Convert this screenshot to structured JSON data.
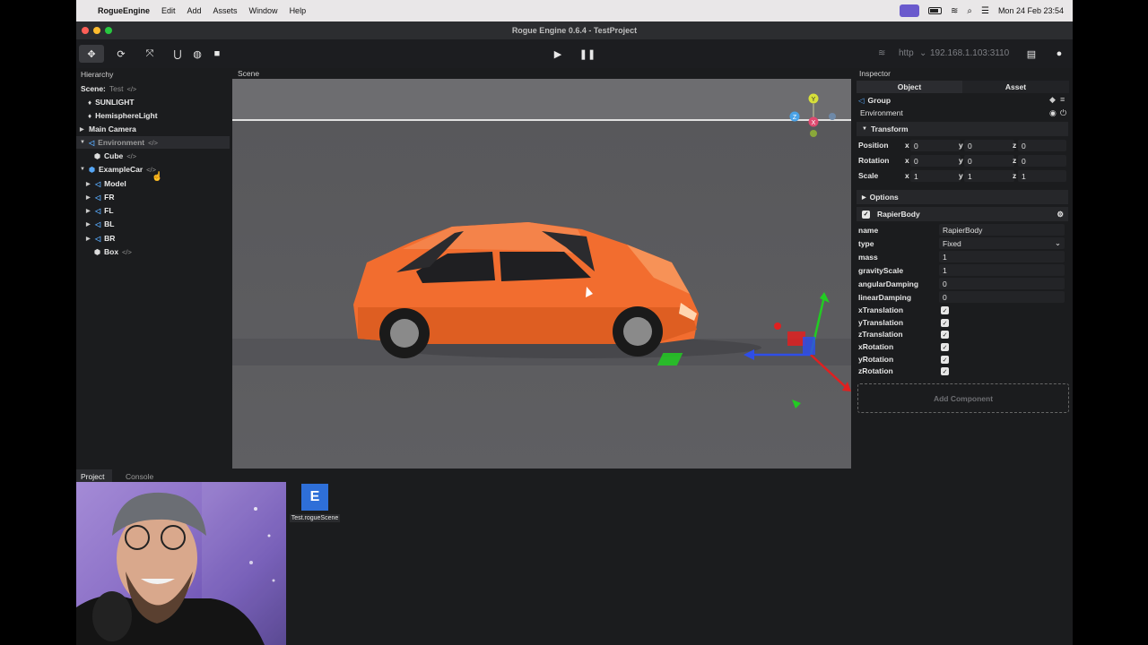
{
  "menubar": {
    "app_name": "RogueEngine",
    "menus": [
      "Edit",
      "Add",
      "Assets",
      "Window",
      "Help"
    ],
    "clock": "Mon 24 Feb  23:54"
  },
  "window": {
    "title": "Rogue Engine 0.6.4 - TestProject"
  },
  "toolbar": {
    "tools": [
      "move-tool",
      "rotate-tool",
      "scale-tool",
      "snap-tool",
      "world-space-tool",
      "camera-tool"
    ],
    "protocol": "http",
    "ip_address": "192.168.1.103:3110"
  },
  "hierarchy": {
    "tab": "Hierarchy",
    "scene_label": "Scene:",
    "scene_name": "Test",
    "items": [
      {
        "label": "SUNLIGHT",
        "icon": "bulb-icon",
        "code": false
      },
      {
        "label": "HemisphereLight",
        "icon": "bulb-icon",
        "code": false
      },
      {
        "label": "Main Camera",
        "icon": "",
        "code": false
      },
      {
        "label": "Environment",
        "icon": "group-icon",
        "code": true
      },
      {
        "label": "Cube",
        "icon": "mesh-icon",
        "code": true
      },
      {
        "label": "ExampleCar",
        "icon": "model-icon",
        "code": true
      },
      {
        "label": "Model",
        "icon": "group-icon",
        "code": false
      },
      {
        "label": "FR",
        "icon": "group-icon",
        "code": false
      },
      {
        "label": "FL",
        "icon": "group-icon",
        "code": false
      },
      {
        "label": "BL",
        "icon": "group-icon",
        "code": false
      },
      {
        "label": "BR",
        "icon": "group-icon",
        "code": false
      },
      {
        "label": "Box",
        "icon": "mesh-icon",
        "code": true
      }
    ]
  },
  "scene": {
    "tab": "Scene",
    "gizmo_axes": [
      "Y",
      "Z",
      "X"
    ]
  },
  "inspector": {
    "tab": "Inspector",
    "subtabs": [
      "Object",
      "Asset"
    ],
    "object_type": "Group",
    "object_name": "Environment",
    "transform": {
      "title": "Transform",
      "rows": [
        {
          "label": "Position",
          "x": "0",
          "y": "0",
          "z": "0"
        },
        {
          "label": "Rotation",
          "x": "0",
          "y": "0",
          "z": "0"
        },
        {
          "label": "Scale",
          "x": "1",
          "y": "1",
          "z": "1"
        }
      ]
    },
    "options_title": "Options",
    "component": {
      "title": "RapierBody",
      "props": [
        {
          "label": "name",
          "value": "RapierBody"
        },
        {
          "label": "type",
          "value": "Fixed"
        },
        {
          "label": "mass",
          "value": "1"
        },
        {
          "label": "gravityScale",
          "value": "1"
        },
        {
          "label": "angularDamping",
          "value": "0"
        },
        {
          "label": "linearDamping",
          "value": "0"
        }
      ],
      "checks": [
        "xTranslation",
        "yTranslation",
        "zTranslation",
        "xRotation",
        "yRotation",
        "zRotation"
      ]
    },
    "add_component": "Add Component"
  },
  "bottom": {
    "tabs": [
      "Project",
      "Console"
    ],
    "asset_file": "Test.rogueScene"
  },
  "colors": {
    "car": "#f26d2f",
    "accent": "#56a6f5"
  }
}
